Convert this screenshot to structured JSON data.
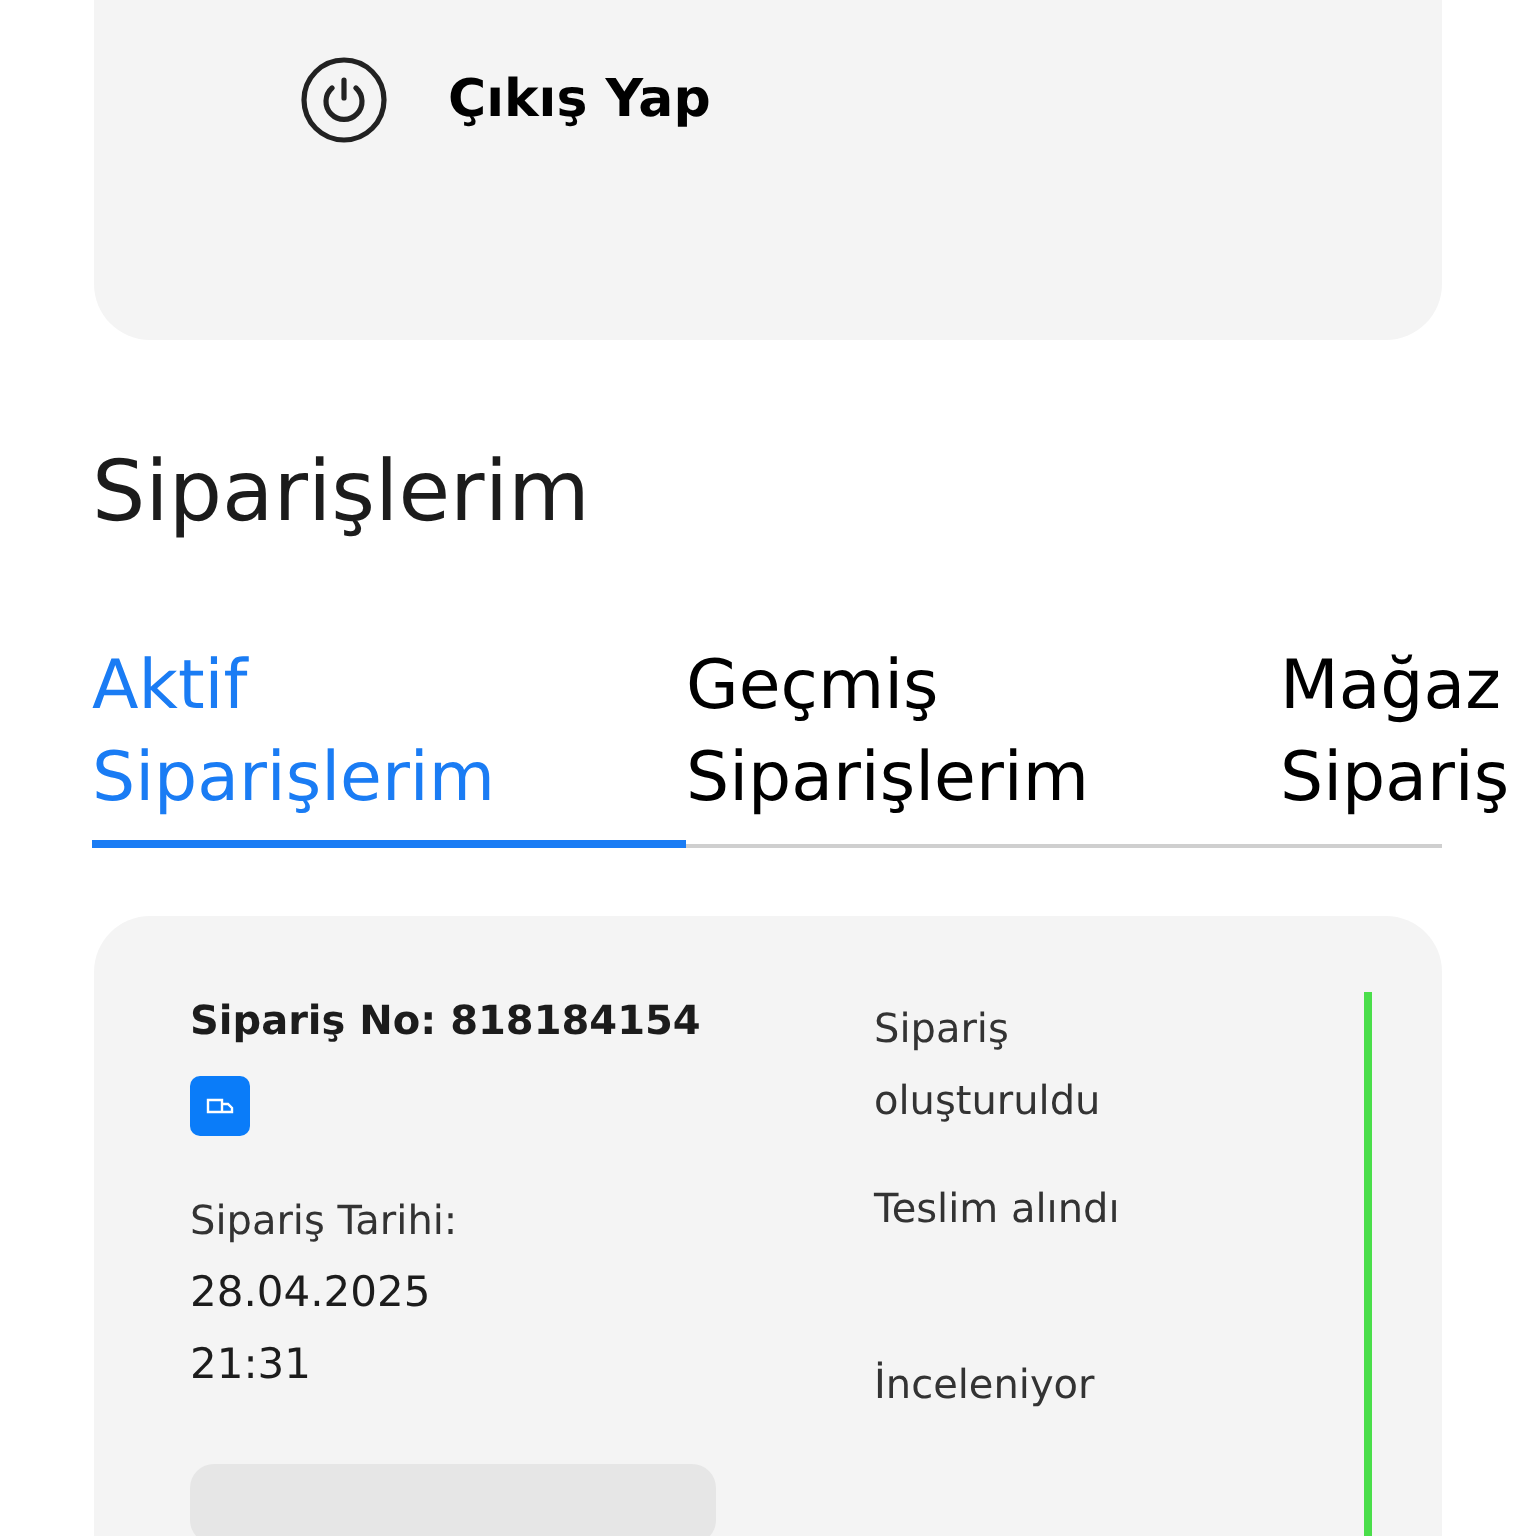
{
  "account_menu": {
    "logout": {
      "label": "Çıkış Yap"
    }
  },
  "orders": {
    "title": "Siparişlerim",
    "tabs": [
      {
        "lines": [
          "Aktif",
          "Siparişlerim"
        ],
        "selected": true
      },
      {
        "lines": [
          "Geçmiş",
          "Siparişlerim"
        ],
        "selected": false
      },
      {
        "lines": [
          "Mağaz",
          "Sipariş"
        ],
        "selected": false
      }
    ],
    "order_card": {
      "order_no": "Sipariş No: 818184154",
      "date_label": "Sipariş Tarihi:",
      "date": "28.04.2025",
      "time": "21:31",
      "statuses": [
        "Sipariş oluşturuldu",
        "Teslim alındı",
        "İnceleniyor"
      ]
    }
  }
}
